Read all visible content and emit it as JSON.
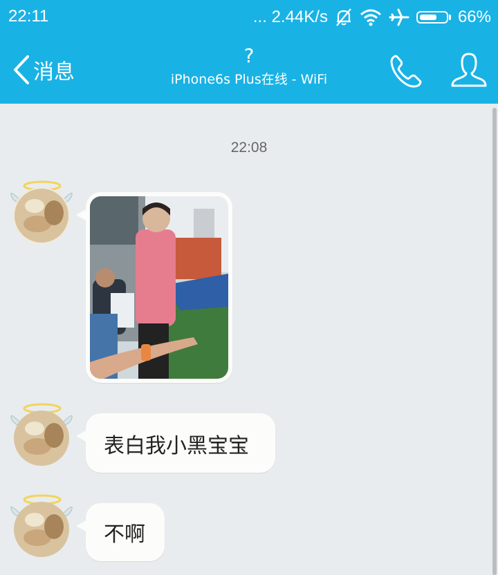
{
  "status_bar": {
    "time": "22:11",
    "net_speed": "... 2.44K/s",
    "battery_percent": "66%",
    "battery_level": 0.66,
    "icons": [
      "bell-off-icon",
      "wifi-icon",
      "airplane-icon",
      "battery-icon"
    ]
  },
  "nav": {
    "back_label": "消息",
    "title": "?",
    "subtitle": "iPhone6s Plus在线 - WiFi",
    "call_icon": "phone-icon",
    "profile_icon": "profile-icon"
  },
  "chat": {
    "timestamp": "22:08",
    "messages": [
      {
        "type": "image",
        "description": "photo"
      },
      {
        "type": "text",
        "text": "表白我小黑宝宝"
      },
      {
        "type": "text",
        "text": "不啊"
      }
    ]
  },
  "colors": {
    "header": "#19b2e5",
    "chat_background": "#e8ecef",
    "bubble": "#fcfdfa"
  }
}
